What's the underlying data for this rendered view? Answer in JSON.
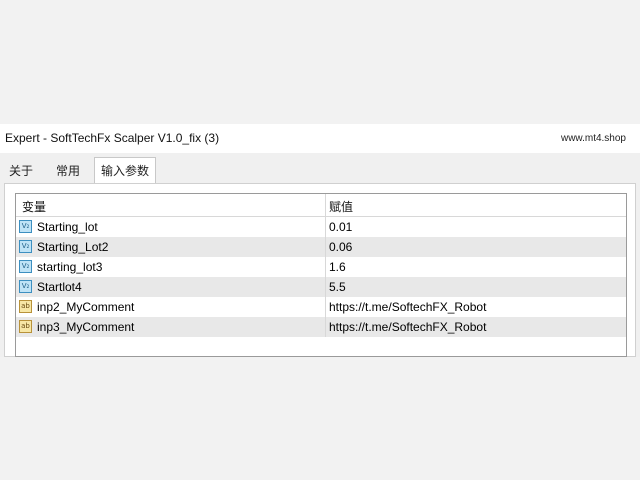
{
  "window": {
    "title": "Expert - SoftTechFx Scalper V1.0_fix (3)",
    "watermark": "www.mt4.shop"
  },
  "tabs": [
    {
      "label": "关于",
      "active": false
    },
    {
      "label": "常用",
      "active": false
    },
    {
      "label": "输入参数",
      "active": true
    }
  ],
  "table": {
    "headers": {
      "variable": "变量",
      "value": "赋值"
    },
    "rows": [
      {
        "icon": "numeric-param-icon",
        "icon_text": "V₂",
        "name": "Starting_lot",
        "value": "0.01"
      },
      {
        "icon": "numeric-param-icon",
        "icon_text": "V₂",
        "name": "Starting_Lot2",
        "value": "0.06"
      },
      {
        "icon": "numeric-param-icon",
        "icon_text": "V₂",
        "name": "starting_lot3",
        "value": "1.6"
      },
      {
        "icon": "numeric-param-icon",
        "icon_text": "V₂",
        "name": "Startlot4",
        "value": "5.5"
      },
      {
        "icon": "string-param-icon",
        "icon_text": "ab",
        "name": "inp2_MyComment",
        "value": "https://t.me/SoftechFX_Robot"
      },
      {
        "icon": "string-param-icon",
        "icon_text": "ab",
        "name": "inp3_MyComment",
        "value": "https://t.me/SoftechFX_Robot"
      }
    ]
  }
}
